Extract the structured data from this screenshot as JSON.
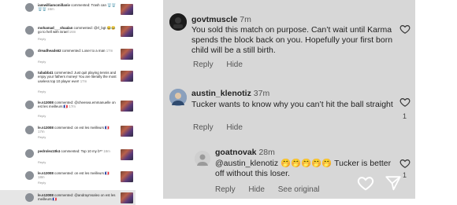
{
  "left_feed": {
    "items": [
      {
        "username": "iamwilliamcmillaniv",
        "action": "commented:",
        "message": "Trash can 🗑️🗑️🗑️🗑️",
        "time": "16m",
        "reply": ""
      },
      {
        "username": "mohamad___shaalan",
        "action": "commented:",
        "message": "@rl_bgt 😂😂 go to hell with israel",
        "time": "16m",
        "reply": "Reply"
      },
      {
        "username": "dreadheads62",
        "action": "commented:",
        "message": "Loser to a man",
        "time": "17m",
        "reply": "Reply"
      },
      {
        "username": "tubabb41",
        "action": "commented:",
        "message": "Just quit playing tennis and enjoy your fathers money! You are literally the most useless top 10 player ever!",
        "time": "17m",
        "reply": "Reply"
      },
      {
        "username": "le.n13008",
        "action": "commented:",
        "message": "@cheesea.emmanuelle on est les meilleurs 🇫🇷",
        "time": "17m",
        "reply": "Reply"
      },
      {
        "username": "le.n13008",
        "action": "commented:",
        "message": "on est les meilleurs 🇫🇷",
        "time": "17m",
        "reply": "Reply"
      },
      {
        "username": "pedrolex10k4",
        "action": "commented:",
        "message": "Top 10 my b** ",
        "time": "18m",
        "reply": "Reply"
      },
      {
        "username": "le.n13008",
        "action": "commented:",
        "message": "on est les meilleurs 🇫🇷",
        "time": "18m",
        "reply": "Reply"
      },
      {
        "username": "le.n13008",
        "action": "commented:",
        "message": "@andraymsaleo on est les meilleurs 🇫🇷",
        "time": "18m",
        "reply": ""
      }
    ]
  },
  "comments": [
    {
      "username": "govtmuscle",
      "time": "7m",
      "body": "You sold this match on purpose. Can’t wait until Karma spends the block back on you. Hopefully your first born child will be a still birth.",
      "reply_label": "Reply",
      "hide_label": "Hide",
      "like_count": ""
    },
    {
      "username": "austin_klenotiz",
      "time": "37m",
      "body": "Tucker wants to know why you can’t hit the ball straight",
      "reply_label": "Reply",
      "hide_label": "Hide",
      "like_count": "1"
    },
    {
      "username": "goatnovak",
      "time": "28m",
      "mention": "@austin_klenotiz",
      "emojis": "🤭🤭🤭🤭🤭",
      "body_rest": " Tucker is better off without this loser.",
      "reply_label": "Reply",
      "hide_label": "Hide",
      "see_original_label": "See original",
      "like_count": "1"
    }
  ],
  "colors": {
    "panel_bg": "#d7d7d7",
    "selected_row": "#e6e6e6"
  }
}
